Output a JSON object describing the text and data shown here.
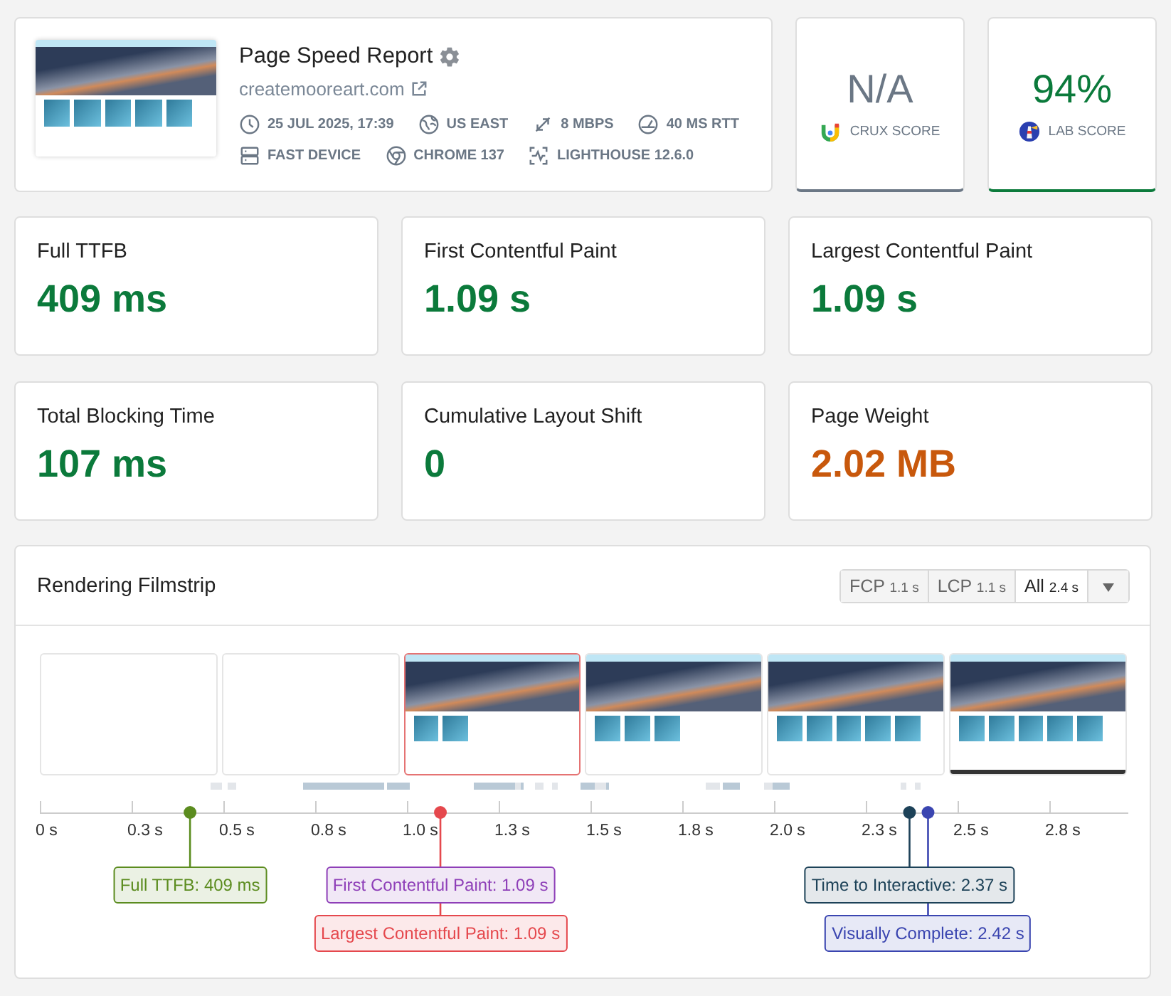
{
  "report": {
    "title": "Page Speed Report",
    "url": "createmooreart.com",
    "meta": [
      {
        "kind": "time",
        "text": "25 JUL 2025, 17:39"
      },
      {
        "kind": "location",
        "text": "US EAST"
      },
      {
        "kind": "bandwidth",
        "text": "8 MBPS"
      },
      {
        "kind": "latency",
        "text": "40 MS RTT"
      },
      {
        "kind": "device",
        "text": "FAST DEVICE"
      },
      {
        "kind": "browser",
        "text": "CHROME 137"
      },
      {
        "kind": "lighthouse",
        "text": "LIGHTHOUSE 12.6.0"
      }
    ]
  },
  "scores": [
    {
      "kind": "crux",
      "value": "N/A",
      "label": "CRUX SCORE",
      "color": "#6b7785"
    },
    {
      "kind": "lab",
      "value": "94%",
      "label": "LAB SCORE",
      "color": "#0b7a3b"
    }
  ],
  "metrics": [
    {
      "label": "Full TTFB",
      "value": "409 ms",
      "color": "#0b7a3b"
    },
    {
      "label": "First Contentful Paint",
      "value": "1.09 s",
      "color": "#0b7a3b"
    },
    {
      "label": "Largest Contentful Paint",
      "value": "1.09 s",
      "color": "#0b7a3b"
    },
    {
      "label": "Total Blocking Time",
      "value": "107 ms",
      "color": "#0b7a3b"
    },
    {
      "label": "Cumulative Layout Shift",
      "value": "0",
      "color": "#0b7a3b"
    },
    {
      "label": "Page Weight",
      "value": "2.02 MB",
      "color": "#c8580c"
    }
  ],
  "filmstrip": {
    "title": "Rendering Filmstrip",
    "filters": [
      {
        "label": "FCP",
        "time": "1.1 s",
        "selected": false
      },
      {
        "label": "LCP",
        "time": "1.1 s",
        "selected": false
      },
      {
        "label": "All",
        "time": "2.4 s",
        "selected": true
      }
    ],
    "frames": [
      {
        "kind": "blank",
        "highlighted": false
      },
      {
        "kind": "blank",
        "highlighted": false
      },
      {
        "kind": "partial",
        "highlighted": true
      },
      {
        "kind": "partial",
        "highlighted": false
      },
      {
        "kind": "complete",
        "highlighted": false
      },
      {
        "kind": "complete",
        "highlighted": false
      }
    ],
    "timeline": {
      "ticks": [
        "0 s",
        "0.3 s",
        "0.5 s",
        "0.8 s",
        "1.0 s",
        "1.3 s",
        "1.5 s",
        "1.8 s",
        "2.0 s",
        "2.3 s",
        "2.5 s",
        "2.8 s"
      ],
      "markers": [
        {
          "label": "Full TTFB: 409 ms",
          "color": "#5b8c1f",
          "level": 0.138
        },
        {
          "label": "First Contentful Paint: 1.09 s",
          "color": "#8e3fb8",
          "level": 0.368
        },
        {
          "label": "Largest Contentful Paint: 1.09 s",
          "color": "#e5484d",
          "level": 0.368
        },
        {
          "label": "Time to Interactive: 2.37 s",
          "color": "#1d4258",
          "level": 0.799
        },
        {
          "label": "Visually Complete: 2.42 s",
          "color": "#3a45b0",
          "level": 0.816
        }
      ]
    }
  }
}
